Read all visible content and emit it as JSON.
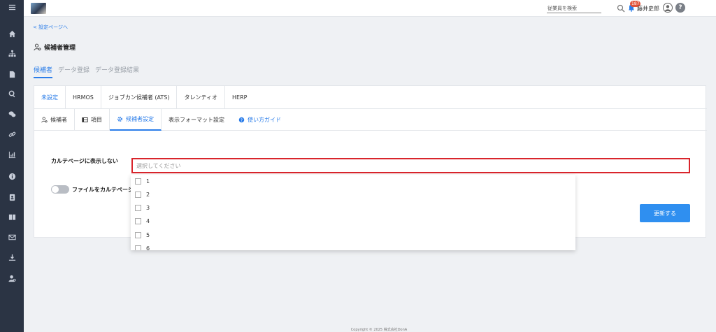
{
  "sidebar": {
    "icons": [
      "menu-icon",
      "home-icon",
      "org-chart-icon",
      "document-icon",
      "search-icon",
      "chat-icon",
      "link-icon",
      "chart-icon",
      "info-icon",
      "contacts-icon",
      "book-icon",
      "mail-icon",
      "download-icon",
      "user-settings-icon"
    ]
  },
  "header": {
    "search_placeholder": "従業員を検索",
    "notification_count": "187",
    "user_name": "藤井史郎",
    "help_label": "?"
  },
  "breadcrumb": {
    "back_label": "< 設定ページへ"
  },
  "page": {
    "title": "候補者管理"
  },
  "main_tabs": [
    {
      "label": "候補者",
      "active": true
    },
    {
      "label": "データ登録",
      "active": false
    },
    {
      "label": "データ登録結果",
      "active": false
    }
  ],
  "integration_tabs": [
    {
      "label": "未設定",
      "active": true
    },
    {
      "label": "HRMOS",
      "active": false
    },
    {
      "label": "ジョブカン候補者 (ATS)",
      "active": false
    },
    {
      "label": "タレンティオ",
      "active": false
    },
    {
      "label": "HERP",
      "active": false
    }
  ],
  "sub_tabs": [
    {
      "label": "候補者",
      "icon": "user-settings-icon",
      "active": false
    },
    {
      "label": "項目",
      "icon": "list-icon",
      "active": false
    },
    {
      "label": "候補者設定",
      "icon": "gear-icon",
      "active": true
    },
    {
      "label": "表示フォーマット設定",
      "icon": "",
      "active": false
    },
    {
      "label": "使い方ガイド",
      "icon": "question-icon",
      "active": false
    }
  ],
  "form": {
    "karte_label": "カルテページに表示しない",
    "select_placeholder": "選択してください",
    "toggle_label": "ファイルをカルテページ",
    "toggle_on": false,
    "update_button": "更新する"
  },
  "dropdown": {
    "options": [
      "1",
      "2",
      "3",
      "4",
      "5",
      "6"
    ]
  },
  "footer": {
    "copyright": "Copyright © 2025 株式会社DonA"
  },
  "colors": {
    "accent": "#2b7de9",
    "sidebar": "#2b3444",
    "highlight": "#d9252c",
    "button": "#2f8ff0"
  }
}
